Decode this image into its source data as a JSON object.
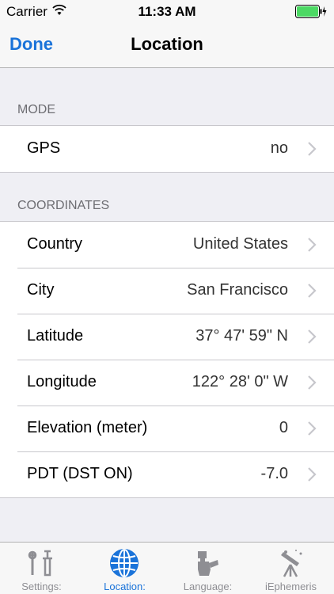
{
  "status_bar": {
    "carrier": "Carrier",
    "time": "11:33 AM"
  },
  "nav": {
    "done_label": "Done",
    "title": "Location"
  },
  "sections": {
    "mode_header": "MODE",
    "coordinates_header": "COORDINATES"
  },
  "mode_rows": [
    {
      "label": "GPS",
      "value": "no"
    }
  ],
  "coordinate_rows": [
    {
      "label": "Country",
      "value": "United States"
    },
    {
      "label": "City",
      "value": "San Francisco"
    },
    {
      "label": "Latitude",
      "value": "37° 47' 59\" N"
    },
    {
      "label": "Longitude",
      "value": "122° 28' 0\" W"
    },
    {
      "label": "Elevation (meter)",
      "value": "0"
    },
    {
      "label": "PDT (DST ON)",
      "value": "-7.0"
    }
  ],
  "tabs": [
    {
      "label": "Settings:",
      "icon": "wrench-screwdriver-icon"
    },
    {
      "label": "Location:",
      "icon": "globe-icon",
      "active": true
    },
    {
      "label": "Language:",
      "icon": "language-icon"
    },
    {
      "label": "iEphemeris",
      "icon": "telescope-icon"
    }
  ],
  "colors": {
    "accent": "#1a73d9",
    "battery": "#4cd964",
    "background": "#efeff4"
  }
}
